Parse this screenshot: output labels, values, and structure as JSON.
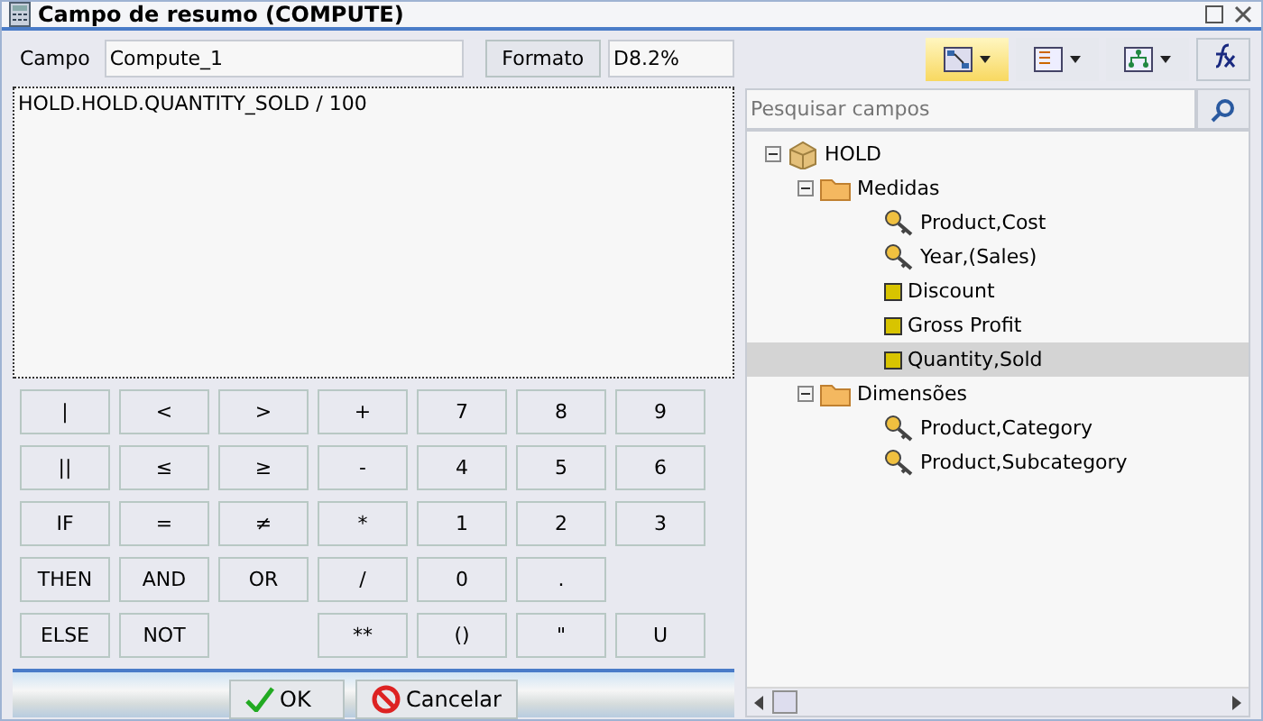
{
  "window": {
    "title": "Campo de resumo (COMPUTE)"
  },
  "field": {
    "label": "Campo",
    "value": "Compute_1"
  },
  "format": {
    "button": "Formato",
    "value": "D8.2%"
  },
  "expression": {
    "value": "HOLD.HOLD.QUANTITY_SOLD / 100"
  },
  "keypad": [
    [
      {
        "kind": "key",
        "label": "|"
      },
      {
        "kind": "key",
        "label": "<"
      },
      {
        "kind": "key",
        "label": ">"
      },
      {
        "kind": "key",
        "label": "+"
      },
      {
        "kind": "key",
        "label": "7"
      },
      {
        "kind": "key",
        "label": "8"
      },
      {
        "kind": "key",
        "label": "9"
      }
    ],
    [
      {
        "kind": "key",
        "label": "||"
      },
      {
        "kind": "key",
        "label": "≤"
      },
      {
        "kind": "key",
        "label": "≥"
      },
      {
        "kind": "key",
        "label": "-"
      },
      {
        "kind": "key",
        "label": "4"
      },
      {
        "kind": "key",
        "label": "5"
      },
      {
        "kind": "key",
        "label": "6"
      }
    ],
    [
      {
        "kind": "key",
        "label": "IF"
      },
      {
        "kind": "key",
        "label": "="
      },
      {
        "kind": "key",
        "label": "≠"
      },
      {
        "kind": "key",
        "label": "*"
      },
      {
        "kind": "key",
        "label": "1"
      },
      {
        "kind": "key",
        "label": "2"
      },
      {
        "kind": "key",
        "label": "3"
      }
    ],
    [
      {
        "kind": "key",
        "label": "THEN"
      },
      {
        "kind": "key",
        "label": "AND"
      },
      {
        "kind": "key",
        "label": "OR"
      },
      {
        "kind": "key",
        "label": "/"
      },
      {
        "kind": "key",
        "label": "0"
      },
      {
        "kind": "key",
        "label": "."
      },
      {
        "kind": "gap"
      }
    ],
    [
      {
        "kind": "key",
        "label": "ELSE"
      },
      {
        "kind": "key",
        "label": "NOT"
      },
      {
        "kind": "gap"
      },
      {
        "kind": "key",
        "label": "**"
      },
      {
        "kind": "key",
        "label": "()"
      },
      {
        "kind": "key",
        "label": "\""
      },
      {
        "kind": "key",
        "label": "U"
      }
    ]
  ],
  "buttons": [
    {
      "kind": "ok",
      "label": "OK"
    },
    {
      "kind": "cancel",
      "label": "Cancelar"
    }
  ],
  "toolbar": [
    {
      "kind": "diagram",
      "selected": true
    },
    {
      "kind": "list",
      "selected": false
    },
    {
      "kind": "hierarchy",
      "selected": false
    }
  ],
  "search": {
    "placeholder": "Pesquisar campos"
  },
  "tree": [
    {
      "kind": "cube",
      "label": "HOLD",
      "expanded": true,
      "selected": false,
      "children": [
        {
          "kind": "folder",
          "label": "Medidas",
          "expanded": true,
          "selected": false,
          "children": [
            {
              "kind": "dimension",
              "label": "Product,Cost",
              "selected": false
            },
            {
              "kind": "dimension",
              "label": "Year,(Sales)",
              "selected": false
            },
            {
              "kind": "measure",
              "label": "Discount",
              "selected": false
            },
            {
              "kind": "measure",
              "label": "Gross Profit",
              "selected": false
            },
            {
              "kind": "measure",
              "label": "Quantity,Sold",
              "selected": true
            }
          ]
        },
        {
          "kind": "folder",
          "label": "Dimensões",
          "expanded": true,
          "selected": false,
          "children": [
            {
              "kind": "dimension",
              "label": "Product,Category",
              "selected": false
            },
            {
              "kind": "dimension",
              "label": "Product,Subcategory",
              "selected": false
            }
          ]
        }
      ]
    }
  ]
}
